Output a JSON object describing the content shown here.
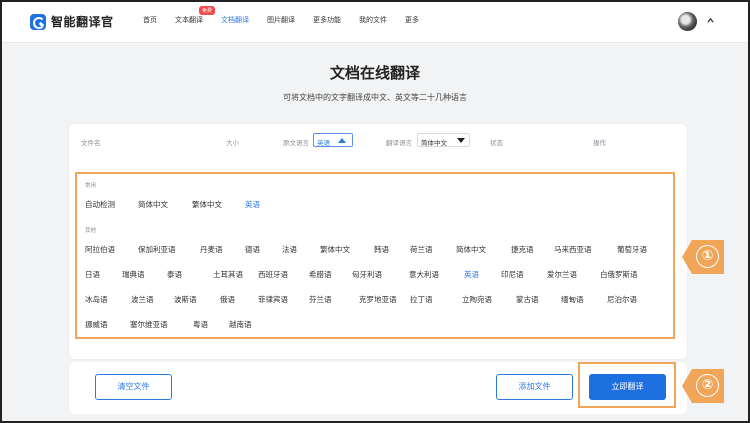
{
  "header": {
    "brand": "智能翻译官",
    "nav": [
      {
        "label": "首页",
        "active": false
      },
      {
        "label": "文本翻译",
        "active": false,
        "badge": "免费"
      },
      {
        "label": "文档翻译",
        "active": true
      },
      {
        "label": "图片翻译",
        "active": false
      },
      {
        "label": "更多功能",
        "active": false
      },
      {
        "label": "我的文件",
        "active": false
      },
      {
        "label": "更多",
        "active": false
      }
    ]
  },
  "page": {
    "title": "文档在线翻译",
    "subtitle": "可将文档中的文字翻译成中文、英文等二十几种语言"
  },
  "table_header": {
    "filename": "文件名",
    "size": "大小",
    "source_label": "原文语言",
    "source_value": "英语",
    "target_label": "翻译语言",
    "target_value": "简体中文",
    "status": "状态",
    "actions": "操作"
  },
  "languages": {
    "common_label": "常用",
    "common": [
      "自动检测",
      "简体中文",
      "繁体中文",
      "英语"
    ],
    "other_label": "其他",
    "other": [
      "阿拉伯语",
      "保加利亚语",
      "丹麦语",
      "德语",
      "法语",
      "繁体中文",
      "韩语",
      "荷兰语",
      "简体中文",
      "捷克语",
      "马来西亚语",
      "葡萄牙语",
      "日语",
      "瑞典语",
      "泰语",
      "土耳其语",
      "西班牙语",
      "希腊语",
      "匈牙利语",
      "意大利语",
      "英语",
      "印尼语",
      "爱尔兰语",
      "白俄罗斯语",
      "冰岛语",
      "波兰语",
      "波斯语",
      "俄语",
      "菲律宾语",
      "芬兰语",
      "克罗地亚语",
      "拉丁语",
      "立陶宛语",
      "蒙古语",
      "缅甸语",
      "尼泊尔语",
      "挪威语",
      "塞尔维亚语",
      "粤语",
      "越南语"
    ],
    "selected": "英语"
  },
  "actions": {
    "clear": "清空文件",
    "add": "添加文件",
    "translate": "立即翻译"
  },
  "callouts": [
    "①",
    "②"
  ],
  "colors": {
    "accent": "#2a7be6",
    "highlight": "#f0a558",
    "badge": "#f24a4a"
  }
}
